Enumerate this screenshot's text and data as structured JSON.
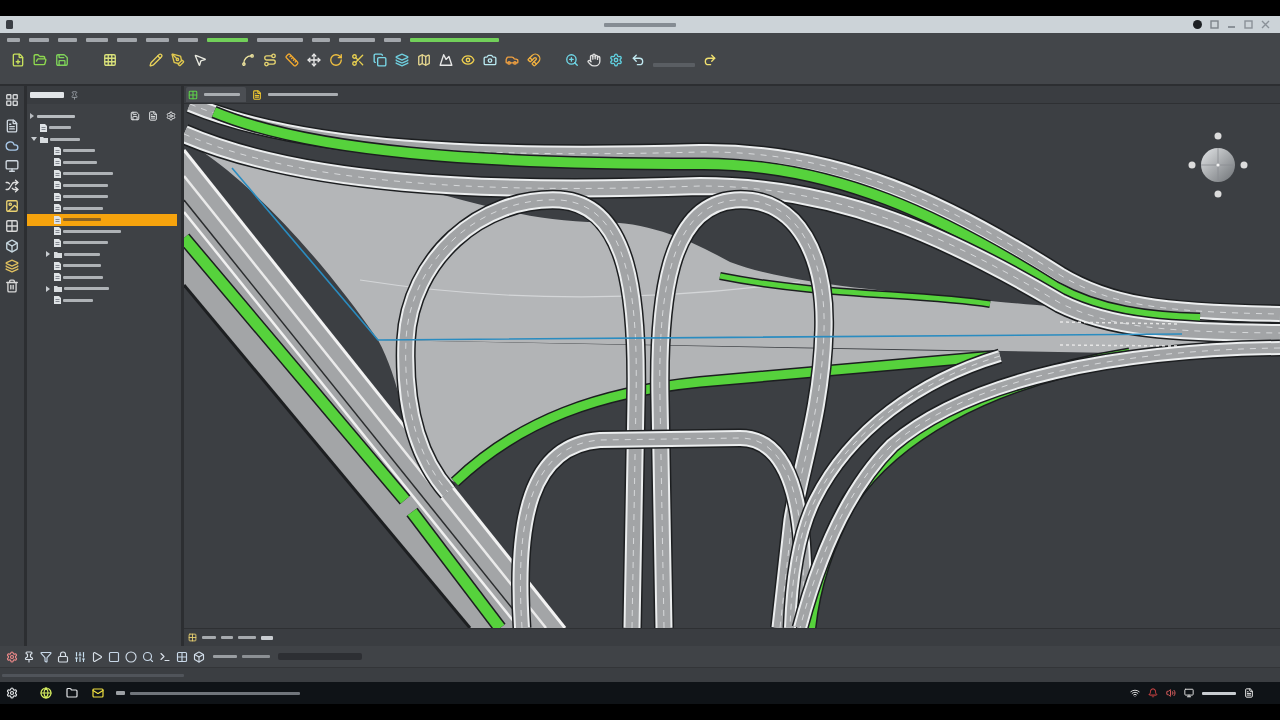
{
  "menu_bar": {
    "items": [
      {
        "color": "#a3a7ac"
      },
      {
        "color": "#a3a7ac"
      },
      {
        "color": "#a3a7ac"
      },
      {
        "color": "#a3a7ac"
      },
      {
        "color": "#a3a7ac"
      },
      {
        "color": "#a3a7ac"
      },
      {
        "color": "#a3a7ac"
      },
      {
        "color": "#72d05a"
      },
      {
        "color": "#a3a7ac"
      },
      {
        "color": "#a3a7ac"
      },
      {
        "color": "#a3a7ac"
      },
      {
        "color": "#a3a7ac"
      },
      {
        "color": "#72d05a"
      }
    ]
  },
  "project_tree": {
    "items": [
      {
        "selected": false
      },
      {
        "selected": false,
        "expanded": true,
        "children": [
          {
            "selected": false
          },
          {
            "selected": false
          },
          {
            "selected": false
          },
          {
            "selected": false
          },
          {
            "selected": false
          },
          {
            "selected": false
          },
          {
            "selected": true
          },
          {
            "selected": false
          },
          {
            "selected": false
          },
          {
            "selected": false,
            "expanded": false
          },
          {
            "selected": false
          },
          {
            "selected": false
          },
          {
            "selected": false,
            "expanded": false
          },
          {
            "selected": false
          }
        ]
      }
    ]
  },
  "viewport": {
    "tabs": [
      {
        "selected": true
      },
      {
        "selected": false
      }
    ]
  }
}
